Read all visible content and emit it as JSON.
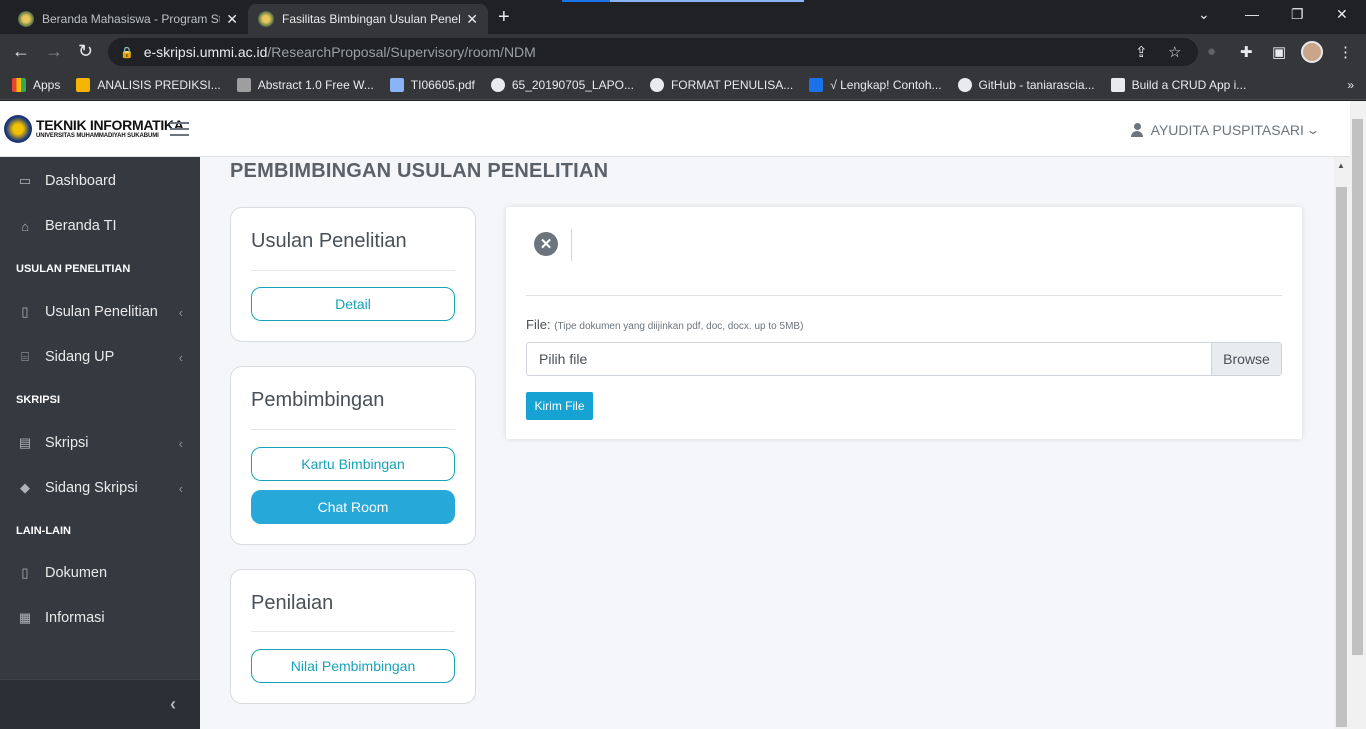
{
  "browser": {
    "tabs": [
      {
        "title": "Beranda Mahasiswa - Program St",
        "close": "✕"
      },
      {
        "title": "Fasilitas Bimbingan Usulan Penel",
        "close": "✕"
      }
    ],
    "new_tab": "+",
    "url_host": "e-skripsi.ummi.ac.id",
    "url_path": "/ResearchProposal/Supervisory/room/NDM",
    "bookmarks": [
      {
        "label": "Apps",
        "color": "#ea4335"
      },
      {
        "label": "ANALISIS PREDIKSI...",
        "color": "#f4b400"
      },
      {
        "label": "Abstract 1.0 Free W...",
        "color": "#9e9e9e"
      },
      {
        "label": "TI06605.pdf",
        "color": "#8ab4f8"
      },
      {
        "label": "65_20190705_LAPO...",
        "color": "#e8eaed"
      },
      {
        "label": "FORMAT PENULISA...",
        "color": "#e8eaed"
      },
      {
        "label": "√ Lengkap! Contoh...",
        "color": "#1a73e8"
      },
      {
        "label": "GitHub - taniarascia...",
        "color": "#e8eaed"
      },
      {
        "label": "Build a CRUD App i...",
        "color": "#e8eaed"
      }
    ],
    "bookmarks_overflow": "»"
  },
  "header": {
    "logo_line1": "TEKNIK INFORMATIKA",
    "logo_line2": "UNIVERSITAS MUHAMMADIYAH SUKABUMI",
    "user_name": "AYUDITA PUSPITASARI"
  },
  "sidebar": {
    "dashboard": "Dashboard",
    "beranda": "Beranda TI",
    "section_usulan": "USULAN PENELITIAN",
    "usulan_penelitian": "Usulan Penelitian",
    "sidang_up": "Sidang UP",
    "section_skripsi": "SKRIPSI",
    "skripsi": "Skripsi",
    "sidang_skripsi": "Sidang Skripsi",
    "section_lain": "LAIN-LAIN",
    "dokumen": "Dokumen",
    "informasi": "Informasi"
  },
  "main": {
    "page_title": "PEMBIMBINGAN USULAN PENELITIAN",
    "card_usulan": {
      "title": "Usulan Penelitian",
      "detail_btn": "Detail"
    },
    "card_pembimbingan": {
      "title": "Pembimbingan",
      "kartu_btn": "Kartu Bimbingan",
      "chat_btn": "Chat Room"
    },
    "card_penilaian": {
      "title": "Penilaian",
      "nilai_btn": "Nilai Pembimbingan"
    },
    "chat": {
      "file_label": "File:",
      "file_hint": "(Tipe dokumen yang diijinkan pdf, doc, docx. up to 5MB)",
      "file_placeholder": "Pilih file",
      "browse_label": "Browse",
      "send_label": "Kirim File"
    }
  },
  "colors": {
    "accent": "#17a2b8",
    "primary_fill": "#26a8d9",
    "sidebar_bg": "#343a40"
  }
}
